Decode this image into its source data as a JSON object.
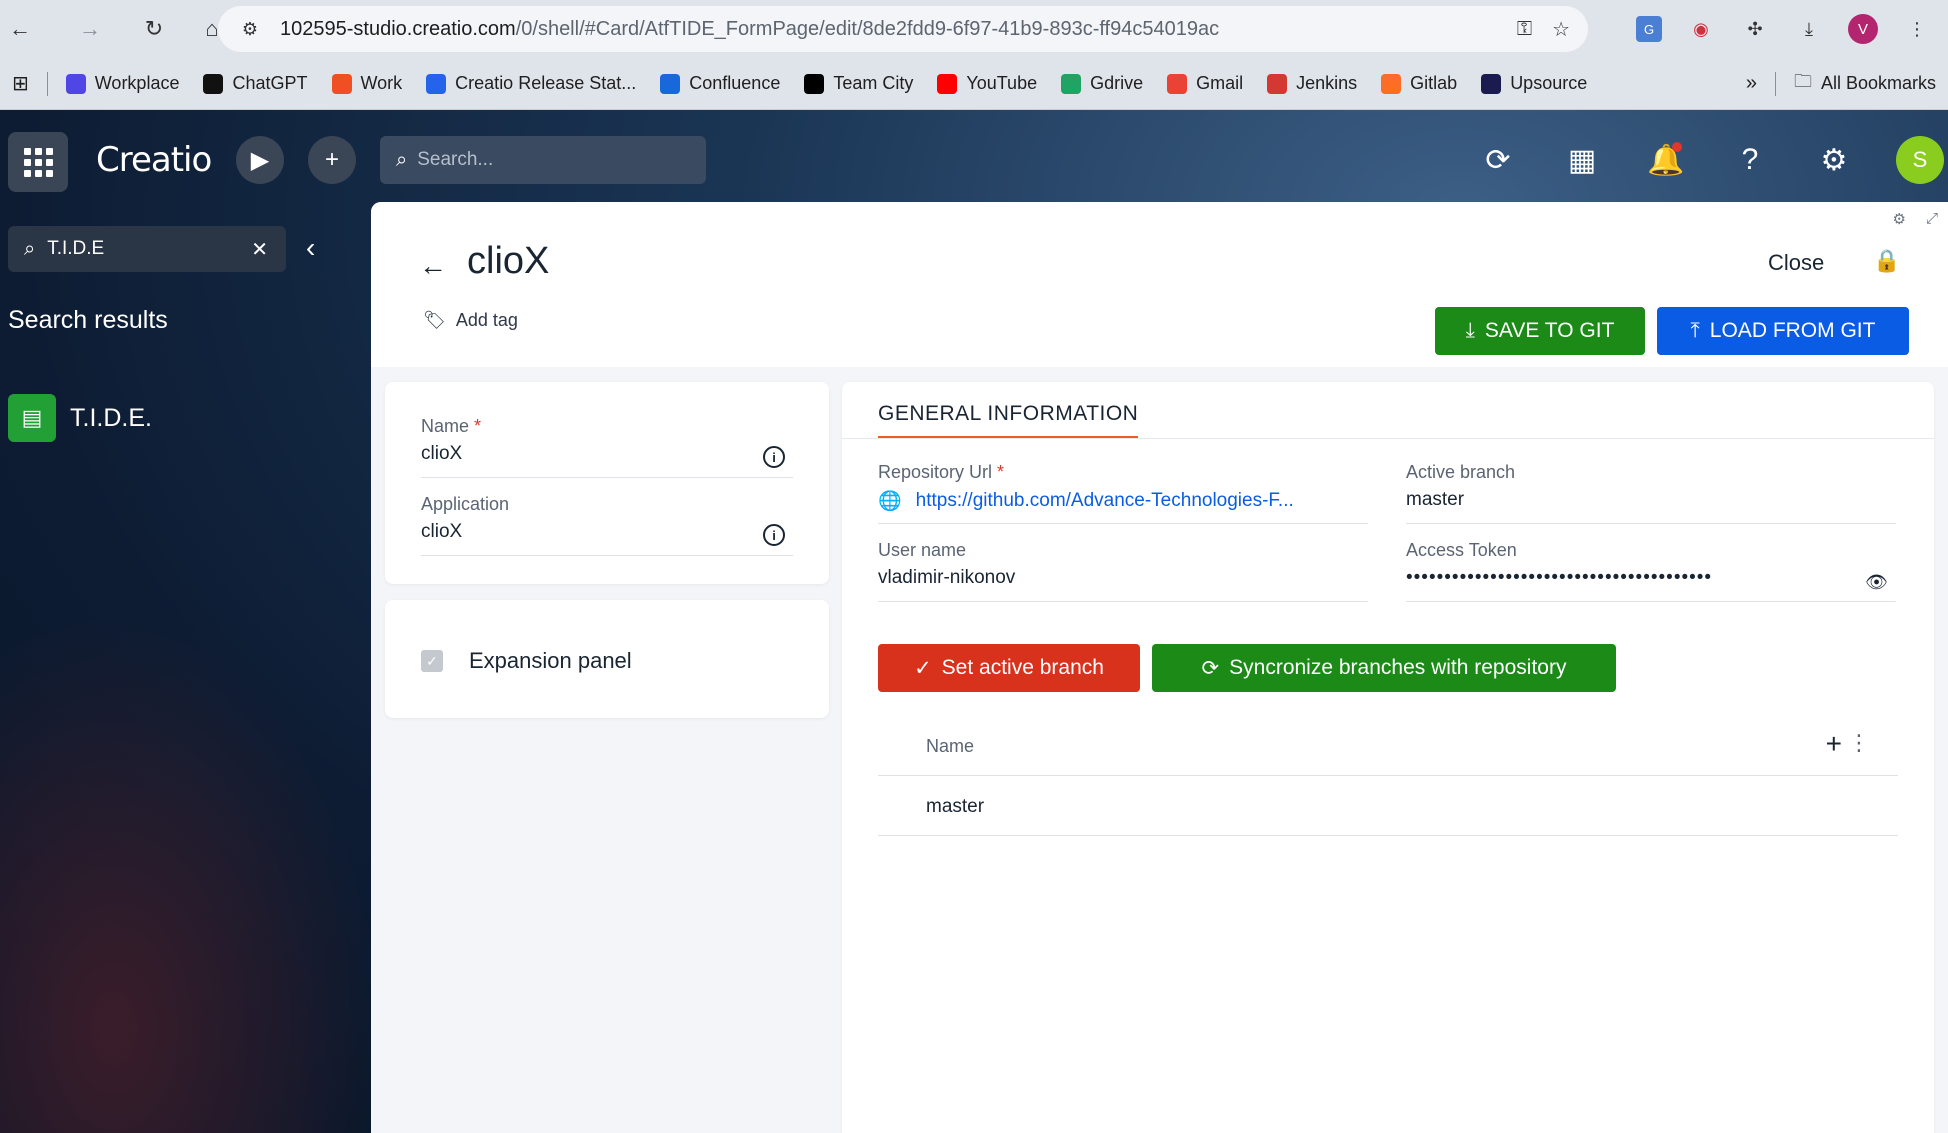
{
  "browser": {
    "url_host": "102595-studio.creatio.com",
    "url_path": "/0/shell/#Card/AtfTIDE_FormPage/edit/8de2fdd9-6f97-41b9-893c-ff94c54019ac",
    "profile_initial": "V",
    "bookmarks": [
      {
        "label": "Workplace",
        "color": "#4f46e5"
      },
      {
        "label": "ChatGPT",
        "color": "#111111"
      },
      {
        "label": "Work",
        "color": "#f04e23"
      },
      {
        "label": "Creatio Release Stat...",
        "color": "#2563eb"
      },
      {
        "label": "Confluence",
        "color": "#1868db"
      },
      {
        "label": "Team City",
        "color": "#000000"
      },
      {
        "label": "YouTube",
        "color": "#ff0000"
      },
      {
        "label": "Gdrive",
        "color": "#1fa463"
      },
      {
        "label": "Gmail",
        "color": "#ea4335"
      },
      {
        "label": "Jenkins",
        "color": "#d33833"
      },
      {
        "label": "Gitlab",
        "color": "#fc6d26"
      },
      {
        "label": "Upsource",
        "color": "#1b1b4f"
      }
    ],
    "all_bookmarks": "All Bookmarks"
  },
  "app": {
    "logo": "Creatio",
    "search_placeholder": "Search...",
    "user_initial": "S"
  },
  "left": {
    "search_value": "T.I.D.E",
    "results_title": "Search results",
    "result_item": "T.I.D.E."
  },
  "card": {
    "title": "clioX",
    "add_tag": "Add tag",
    "close": "Close",
    "save_to_git": "SAVE TO GIT",
    "load_from_git": "LOAD FROM GIT",
    "name_label": "Name",
    "name_value": "clioX",
    "application_label": "Application",
    "application_value": "clioX",
    "expansion_panel": "Expansion panel",
    "tab_general": "GENERAL INFORMATION",
    "repo_url_label": "Repository Url",
    "repo_url_value": "https://github.com/Advance-Technologies-F...",
    "active_branch_label": "Active branch",
    "active_branch_value": "master",
    "user_name_label": "User name",
    "user_name_value": "vladimir-nikonov",
    "access_token_label": "Access Token",
    "access_token_value": "••••••••••••••••••••••••••••••••••••••••",
    "set_active_branch": "Set active branch",
    "sync_branches": "Syncronize branches with repository",
    "table_header_name": "Name",
    "table_rows": [
      "master"
    ]
  }
}
